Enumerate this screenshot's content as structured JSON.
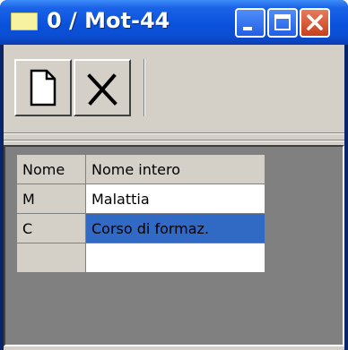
{
  "window": {
    "title": "0 / Mot-44"
  },
  "titlebar_buttons": {
    "minimize": "minimize-icon",
    "maximize": "maximize-icon",
    "close": "close-icon"
  },
  "toolbar": {
    "new_icon": "new-document-icon",
    "delete_icon": "delete-x-icon"
  },
  "grid": {
    "columns": [
      "Nome",
      "Nome intero"
    ],
    "rows": [
      {
        "code": "M",
        "name": "Malattia"
      },
      {
        "code": "C",
        "name": "Corso di formaz."
      },
      {
        "code": "",
        "name": ""
      }
    ],
    "selected_row": 1
  },
  "colors": {
    "title_blue": "#0a52dc",
    "selection": "#316ac5",
    "face": "#d4d0c8",
    "close_button": "#c8401c"
  }
}
